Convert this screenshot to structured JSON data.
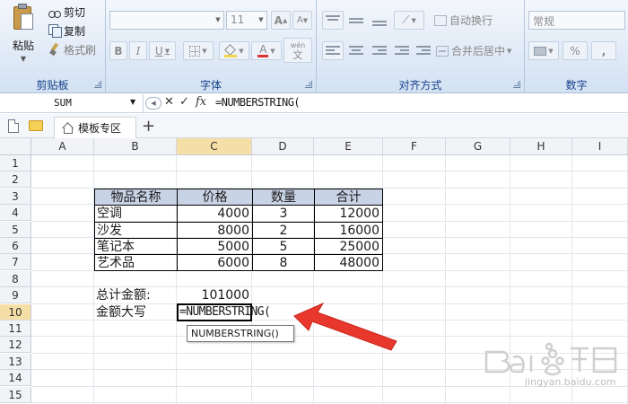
{
  "ribbon": {
    "clipboard": {
      "paste": "粘贴",
      "cut": "剪切",
      "copy": "复制",
      "format_painter": "格式刷",
      "label": "剪贴板"
    },
    "font": {
      "font_name": "",
      "font_size": "11",
      "grow": "A",
      "shrink": "A",
      "bold": "B",
      "italic": "I",
      "underline": "U",
      "font_color_letter": "A",
      "phonetic_top": "wén",
      "phonetic_bottom": "文",
      "label": "字体"
    },
    "alignment": {
      "wrap_text": "自动换行",
      "merge_center": "合并后居中",
      "label": "对齐方式"
    },
    "number": {
      "format": "常规",
      "percent": "%",
      "comma": ",",
      "label": "数字"
    }
  },
  "formula_bar": {
    "name_box": "SUM",
    "cancel": "✕",
    "enter": "✓",
    "fx": "fx",
    "formula": "=NUMBERSTRING("
  },
  "tabs": {
    "sheet_tab": "模板专区",
    "new_tab": "+"
  },
  "grid": {
    "columns": [
      "A",
      "B",
      "C",
      "D",
      "E",
      "F",
      "G",
      "H",
      "I"
    ],
    "rows": [
      "1",
      "2",
      "3",
      "4",
      "5",
      "6",
      "7",
      "8",
      "9",
      "10",
      "11",
      "12",
      "13",
      "14",
      "15"
    ],
    "selected_column": "C",
    "selected_row": "10"
  },
  "table": {
    "headers": [
      "物品名称",
      "价格",
      "数量",
      "合计"
    ],
    "rows": [
      [
        "空调",
        "4000",
        "3",
        "12000"
      ],
      [
        "沙发",
        "8000",
        "2",
        "16000"
      ],
      [
        "笔记本",
        "5000",
        "5",
        "25000"
      ],
      [
        "艺术品",
        "6000",
        "8",
        "48000"
      ]
    ]
  },
  "summary": {
    "total_label": "总计金额:",
    "total_value": "101000",
    "upper_label": "金额大写",
    "editing_value": "=NUMBERSTRING(",
    "tooltip": "NUMBERSTRING()"
  },
  "colors": {
    "header_fill": "#c9d3e6",
    "selected_header": "#f6dfa6",
    "arrow": "#e8372c"
  },
  "watermark": {
    "text": "jingyan.baidu.com"
  }
}
